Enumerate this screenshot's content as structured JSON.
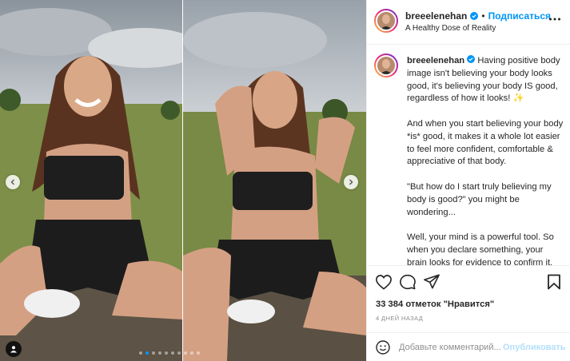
{
  "post": {
    "username": "breeelenehan",
    "follow_label": "Подписаться",
    "separator": "•",
    "location": "A Healthy Dose of Reality",
    "caption_paragraphs": [
      "Having positive body image isn't believing your body looks good, it's believing your body IS good, regardless of how it looks! ✨",
      "And when you start believing your body *is* good, it makes it a whole lot easier to feel more confident, comfortable & appreciative of that body.",
      "\"But how do I start truly believing my body is good?\" you might be wondering...",
      "Well, your mind is a powerful tool. So when you declare something, your brain looks for evidence to confirm it. So if you declare: \"I'm not good enough\", your brain is going to seek everything in your"
    ],
    "likes": "33 384 отметок \"Нравится\"",
    "date": "4 ДНЕЙ НАЗАД",
    "comment_placeholder": "Добавьте комментарий...",
    "publish_label": "Опубликовать"
  },
  "carousel": {
    "total_slides": 10,
    "active_slide": 2
  },
  "icons": {
    "verified": "verified-badge-icon",
    "more": "more-options-icon",
    "like": "heart-icon",
    "comment": "comment-icon",
    "share": "share-icon",
    "save": "bookmark-icon",
    "emoji": "emoji-icon",
    "prev": "chevron-left-icon",
    "next": "chevron-right-icon",
    "tags": "user-tag-icon"
  },
  "colors": {
    "accent": "#0095f6",
    "publish_disabled": "#b2dffc",
    "muted": "#8e8e8e"
  }
}
